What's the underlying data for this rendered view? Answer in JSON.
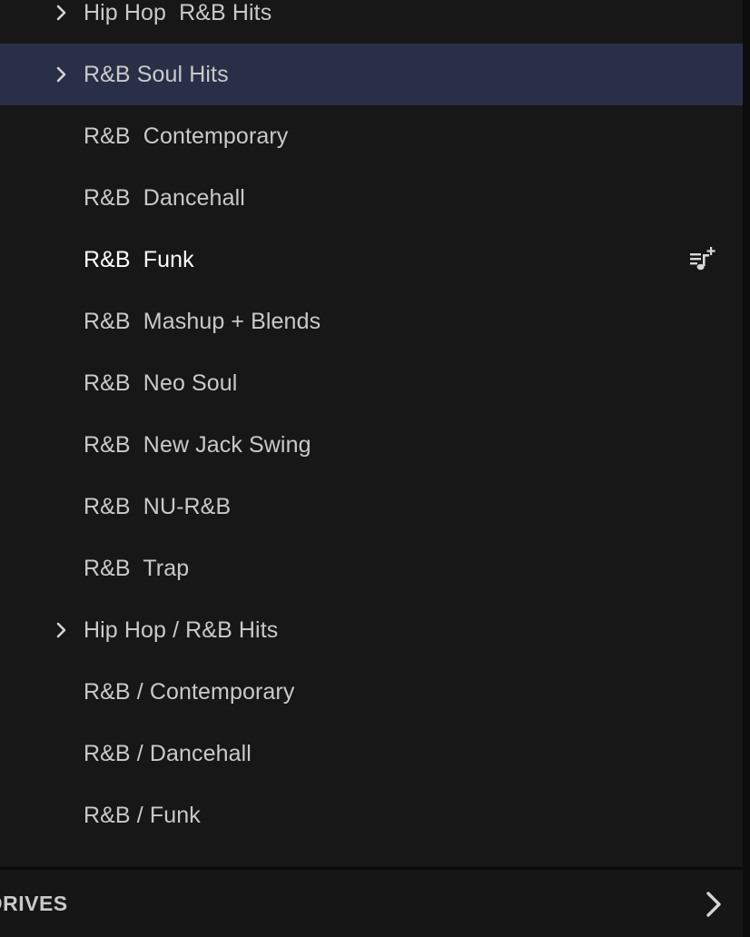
{
  "tree": {
    "items": [
      {
        "label": "Hip Hop  R&B Hits",
        "expandable": true,
        "selected": false,
        "active": false
      },
      {
        "label": "R&B Soul Hits",
        "expandable": true,
        "selected": true,
        "active": false
      },
      {
        "label": "R&B  Contemporary",
        "expandable": false,
        "selected": false,
        "active": false
      },
      {
        "label": "R&B  Dancehall",
        "expandable": false,
        "selected": false,
        "active": false
      },
      {
        "label": "R&B  Funk",
        "expandable": false,
        "selected": false,
        "active": true,
        "action_icon": "add-to-queue-icon"
      },
      {
        "label": "R&B  Mashup + Blends",
        "expandable": false,
        "selected": false,
        "active": false
      },
      {
        "label": "R&B  Neo Soul",
        "expandable": false,
        "selected": false,
        "active": false
      },
      {
        "label": "R&B  New Jack Swing",
        "expandable": false,
        "selected": false,
        "active": false
      },
      {
        "label": "R&B  NU-R&B",
        "expandable": false,
        "selected": false,
        "active": false
      },
      {
        "label": "R&B  Trap",
        "expandable": false,
        "selected": false,
        "active": false
      },
      {
        "label": "Hip Hop / R&B Hits",
        "expandable": true,
        "selected": false,
        "active": false
      },
      {
        "label": "R&B / Contemporary",
        "expandable": false,
        "selected": false,
        "active": false
      },
      {
        "label": "R&B / Dancehall",
        "expandable": false,
        "selected": false,
        "active": false
      },
      {
        "label": "R&B / Funk",
        "expandable": false,
        "selected": false,
        "active": false
      }
    ]
  },
  "drives": {
    "label": "DRIVES",
    "icon": "chevron-right-icon"
  },
  "colors": {
    "background": "#171718",
    "selected_row": "#2a2f48",
    "text": "#c9c9cb",
    "active_text": "#ffffff"
  }
}
